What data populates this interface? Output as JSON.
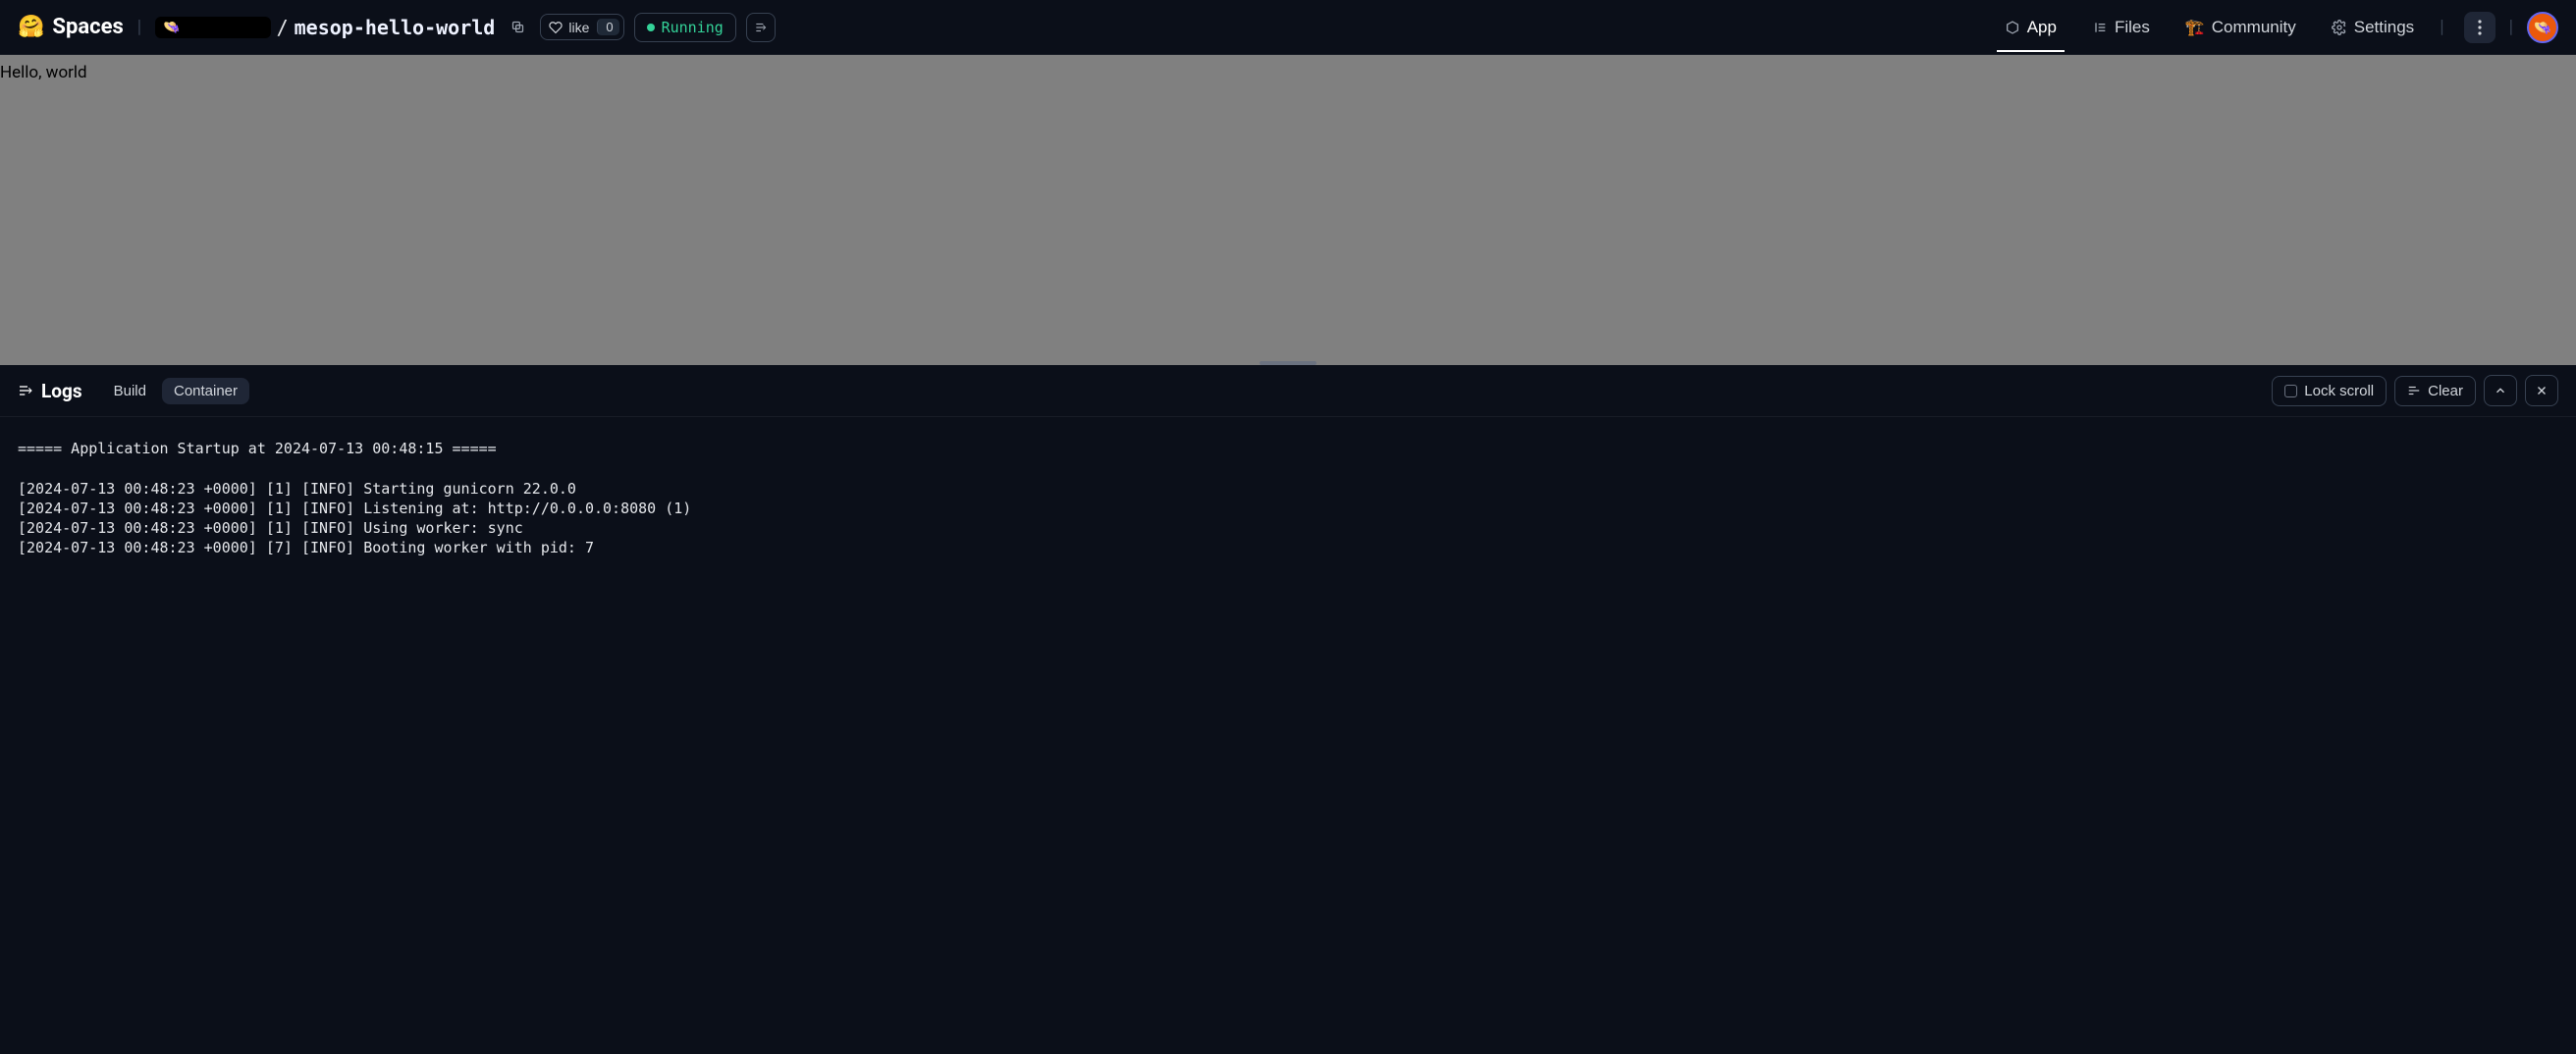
{
  "header": {
    "spaces_label": "Spaces",
    "owner_emoji": "👒",
    "path_separator": "/",
    "repo_name": "mesop-hello-world",
    "like_label": "like",
    "like_count": "0",
    "status_text": "Running"
  },
  "nav": {
    "app": "App",
    "files": "Files",
    "community": "Community",
    "settings": "Settings"
  },
  "app": {
    "content": "Hello, world"
  },
  "logs": {
    "title": "Logs",
    "tabs": {
      "build": "Build",
      "container": "Container"
    },
    "lock_scroll": "Lock scroll",
    "clear": "Clear",
    "lines": "===== Application Startup at 2024-07-13 00:48:15 =====\n\n[2024-07-13 00:48:23 +0000] [1] [INFO] Starting gunicorn 22.0.0\n[2024-07-13 00:48:23 +0000] [1] [INFO] Listening at: http://0.0.0.0:8080 (1)\n[2024-07-13 00:48:23 +0000] [1] [INFO] Using worker: sync\n[2024-07-13 00:48:23 +0000] [7] [INFO] Booting worker with pid: 7"
  }
}
